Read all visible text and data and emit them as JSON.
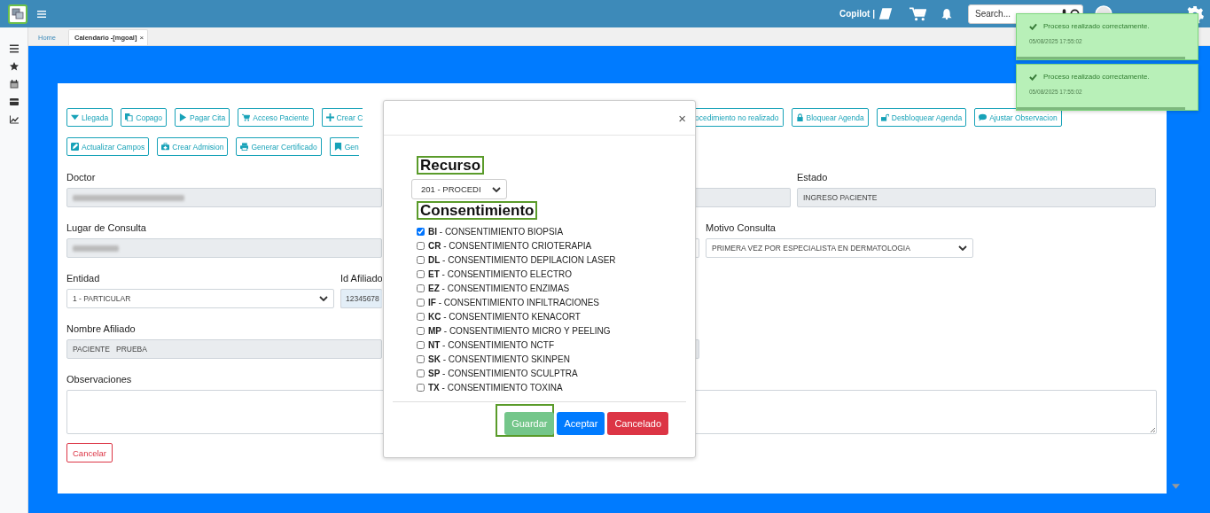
{
  "topbar": {
    "copilot": "Copilot |",
    "search": {
      "placeholder": "Search..."
    }
  },
  "tabs": [
    {
      "label": "Home",
      "selected": false
    },
    {
      "label": "Calendario -[mgoal]",
      "selected": true,
      "close": "×"
    }
  ],
  "toolbar": {
    "row_1_left": [
      "Llegada",
      "Copago",
      "Pagar Cita",
      "Acceso Paciente",
      "Crear C"
    ],
    "row_1_right": [
      "ocedimiento no realizado",
      "Bloquear Agenda",
      "Desbloquear Agenda",
      "Ajustar Observacion"
    ],
    "row_2_left": [
      "Actualizar Campos",
      "Crear Admision",
      "Generar Certificado",
      "Gen"
    ]
  },
  "form": {
    "doctor": {
      "label": "Doctor"
    },
    "estado": {
      "label": "Estado",
      "value": "INGRESO PACIENTE"
    },
    "lugar": {
      "label": "Lugar de Consulta"
    },
    "motivo": {
      "label": "Motivo Consulta",
      "value": "PRIMERA VEZ POR ESPECIALISTA EN DERMATOLOGIA"
    },
    "entidad": {
      "label": "Entidad",
      "value": "1 - PARTICULAR"
    },
    "id_afiliado": {
      "label": "Id Afiliado",
      "value": "12345678"
    },
    "nombre": {
      "label": "Nombre Afiliado",
      "value": "PACIENTE   PRUEBA"
    },
    "observaciones": {
      "label": "Observaciones"
    },
    "cancel_button": "Cancelar"
  },
  "modal": {
    "close": "×",
    "recurso_title": "Recurso",
    "recurso_value": "201 - PROCEDI",
    "consent_title": "Consentimiento",
    "consents": [
      {
        "text": "**BI** - CONSENTIMIENTO BIOPSIA",
        "checked": true
      },
      {
        "text": "**CR** - CONSENTIMIENTO CRIOTERAPIA",
        "checked": false
      },
      {
        "text": "**DL** - CONSENTIMIENTO DEPILACION LASER",
        "checked": false
      },
      {
        "text": "**ET** - CONSENTIMIENTO ELECTRO",
        "checked": false
      },
      {
        "text": "**EZ** - CONSENTIMIENTO ENZIMAS",
        "checked": false
      },
      {
        "text": "**IF** - CONSENTIMIENTO INFILTRACIONES",
        "checked": false
      },
      {
        "text": "**KC** - CONSENTIMIENTO KENACORT",
        "checked": false
      },
      {
        "text": "**MP** - CONSENTIMIENTO MICRO Y PEELING",
        "checked": false
      },
      {
        "text": "**NT** - CONSENTIMIENTO NCTF",
        "checked": false
      },
      {
        "text": "**SK** - CONSENTIMIENTO SKINPEN",
        "checked": false
      },
      {
        "text": "**SP** - CONSENTIMIENTO SCULPTRA",
        "checked": false
      },
      {
        "text": "**TX** - CONSENTIMIENTO TOXINA",
        "checked": false
      }
    ],
    "buttons": [
      {
        "label": "Guardar",
        "kind": "save"
      },
      {
        "label": "Aceptar",
        "kind": "accept"
      },
      {
        "label": "Cancelado",
        "kind": "cancel"
      }
    ]
  },
  "toasts": [
    {
      "message": "Proceso realizado correctamente.",
      "time": "05/08/2025 17:55:02",
      "level": 0.93
    },
    {
      "message": "Proceso realizado correctamente.",
      "time": "05/08/2025 17:55:02",
      "level": 0.93
    }
  ]
}
